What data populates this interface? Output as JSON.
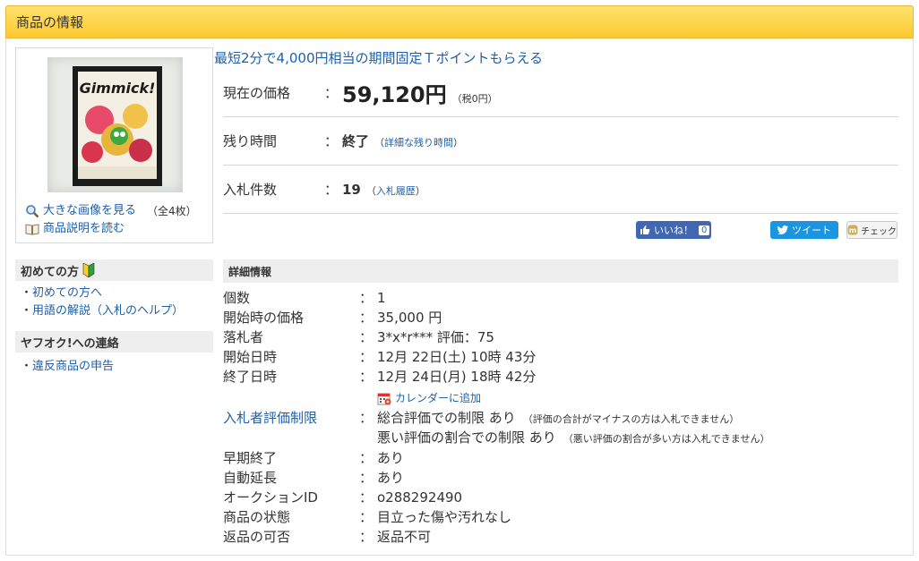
{
  "header": {
    "title": "商品の情報"
  },
  "image_box": {
    "thumbnail_title": "Gimmick!",
    "view_large_label": "大きな画像を見る",
    "image_count": "（全4枚）",
    "read_description_label": "商品説明を読む"
  },
  "sidebar": {
    "beginners_title": "初めての方",
    "beginners_links": [
      "初めての方へ",
      "用語の解説（入札のヘルプ）"
    ],
    "contact_title": "ヤフオク!への連絡",
    "contact_links": [
      "違反商品の申告"
    ]
  },
  "promo": "最短2分で4,000円相当の期間固定Ｔポイントもらえる",
  "price_rows": {
    "current_price": {
      "label": "現在の価格",
      "colon": "：",
      "value": "59,120円",
      "note": "（税0円）"
    },
    "time_left": {
      "label": "残り時間",
      "colon": "：",
      "value": "終了",
      "note_open": "（",
      "note_link": "詳細な残り時間",
      "note_close": "）"
    },
    "bid_count": {
      "label": "入札件数",
      "colon": "：",
      "value": "19",
      "note_open": "（",
      "note_link": "入札履歴",
      "note_close": "）"
    }
  },
  "social": {
    "like_label": "いいね！",
    "like_count": "0",
    "tweet_label": "ツイート",
    "check_label": "チェック"
  },
  "details": {
    "title": "詳細情報",
    "colon": "：",
    "rows": [
      {
        "label": "個数",
        "value": "1"
      },
      {
        "label": "開始時の価格",
        "value": "35,000 円"
      },
      {
        "label": "落札者",
        "value": "3*x*r*** 評価：75"
      },
      {
        "label": "開始日時",
        "value": "12月 22日(土) 10時 43分"
      },
      {
        "label": "終了日時",
        "value": "12月 24日(月) 18時 42分"
      }
    ],
    "calendar_link": "カレンダーに追加",
    "bidder_restriction": {
      "label": "入札者評価制限",
      "line1": "総合評価での制限 あり",
      "note1": "（評価の合計がマイナスの方は入札できません）",
      "line2": "悪い評価の割合での制限 あり",
      "note2": "（悪い評価の割合が多い方は入札できません）"
    },
    "rows2": [
      {
        "label": "早期終了",
        "value": "あり"
      },
      {
        "label": "自動延長",
        "value": "あり"
      },
      {
        "label": "オークションID",
        "value": "o288292490"
      },
      {
        "label": "商品の状態",
        "value": "目立った傷や汚れなし"
      },
      {
        "label": "返品の可否",
        "value": "返品不可"
      }
    ]
  }
}
